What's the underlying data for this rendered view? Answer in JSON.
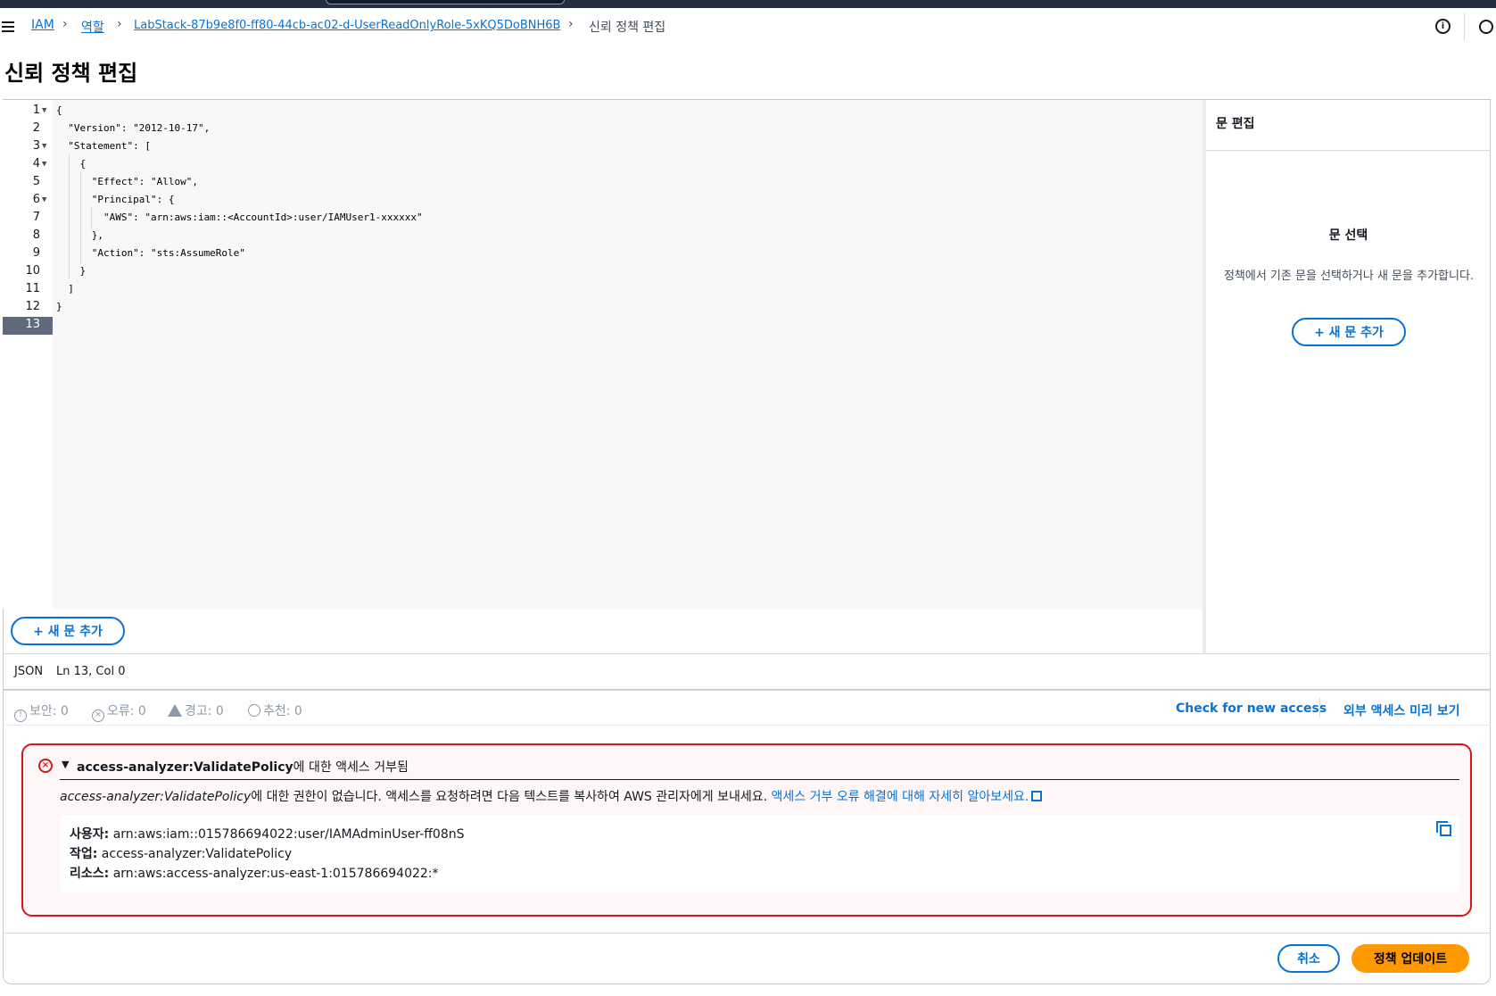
{
  "breadcrumbs": {
    "items": [
      {
        "label": "IAM"
      },
      {
        "label": "역할"
      },
      {
        "label": "LabStack-87b9e8f0-ff80-44cb-ac02-d-UserReadOnlyRole-5xKQ5DoBNH6B"
      },
      {
        "label": "신뢰 정책 편집"
      }
    ]
  },
  "page": {
    "title": "신뢰 정책 편집"
  },
  "editor": {
    "lines": [
      {
        "n": "1",
        "text": "{"
      },
      {
        "n": "2",
        "text": "  \"Version\": \"2012-10-17\","
      },
      {
        "n": "3",
        "text": "  \"Statement\": ["
      },
      {
        "n": "4",
        "text": "    {"
      },
      {
        "n": "5",
        "text": "      \"Effect\": \"Allow\","
      },
      {
        "n": "6",
        "text": "      \"Principal\": {"
      },
      {
        "n": "7",
        "text": "        \"AWS\": \"arn:aws:iam::<AccountId>:user/IAMUser1-xxxxxx\""
      },
      {
        "n": "8",
        "text": "      },"
      },
      {
        "n": "9",
        "text": "      \"Action\": \"sts:AssumeRole\""
      },
      {
        "n": "10",
        "text": "    }"
      },
      {
        "n": "11",
        "text": "  ]"
      },
      {
        "n": "12",
        "text": "}"
      },
      {
        "n": "13",
        "text": ""
      }
    ],
    "add_statement_label": "+ 새 문 추가"
  },
  "side_panel": {
    "title": "문 편집",
    "heading": "문 선택",
    "description": "정책에서 기존 문을 선택하거나 새 문을 추가합니다.",
    "add_button_label": "+ 새 문 추가"
  },
  "status": {
    "language": "JSON",
    "position": "Ln 13, Col 0"
  },
  "checks": {
    "security": "보안: 0",
    "errors": "오류: 0",
    "warnings": "경고: 0",
    "suggestions": "추천: 0",
    "check_access_label": "Check for new access",
    "preview_label": "외부 액세스 미리 보기"
  },
  "error_alert": {
    "title_action": "access-analyzer:ValidatePolicy",
    "title_suffix": "에 대한 액세스 거부됨",
    "message_action": "access-analyzer:ValidatePolicy",
    "message_text": "에 대한 권한이 없습니다. 액세스를 요청하려면 다음 텍스트를 복사하여 AWS 관리자에게 보내세요. ",
    "message_link": "액세스 거부 오류 해결에 대해 자세히 알아보세요.",
    "user_label": "사용자:",
    "user_value": " arn:aws:iam::015786694022:user/IAMAdminUser-ff08nS",
    "action_label": "작업:",
    "action_value": " access-analyzer:ValidatePolicy",
    "resource_label": "리소스:",
    "resource_value": " arn:aws:access-analyzer:us-east-1:015786694022:*"
  },
  "footer": {
    "cancel_label": "취소",
    "update_label": "정책 업데이트"
  },
  "colors": {
    "link": "#0972d3",
    "error": "#d91515",
    "primary_button": "#ff9900",
    "topbar": "#232f3e"
  }
}
